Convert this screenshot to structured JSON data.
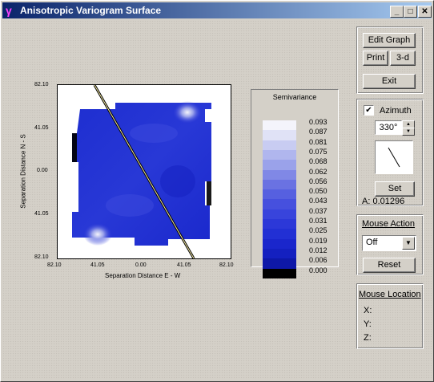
{
  "window": {
    "title": "Anisotropic Variogram Surface",
    "minimize": "_",
    "maximize": "□",
    "close": "✕",
    "icon": "gamma-app-icon"
  },
  "buttons": {
    "edit_graph": "Edit Graph",
    "print": "Print",
    "three_d": "3-d",
    "exit": "Exit",
    "set": "Set",
    "reset": "Reset"
  },
  "azimuth": {
    "label": "Azimuth",
    "checked": true,
    "value": "330°",
    "anisotropy": "A: 0.01296"
  },
  "mouse_action": {
    "title": "Mouse Action",
    "selected": "Off"
  },
  "mouse_location": {
    "title": "Mouse Location",
    "x_label": "X:",
    "y_label": "Y:",
    "z_label": "Z:"
  },
  "chart_data": {
    "type": "heatmap",
    "title": "",
    "xlabel": "Separation Distance E - W",
    "ylabel": "Separation Distance N - S",
    "x_ticks": [
      "82.10",
      "41.05",
      "0.00",
      "41.05",
      "82.10"
    ],
    "y_ticks": [
      "82.10",
      "41.05",
      "0.00",
      "41.05",
      "82.10"
    ],
    "legend": {
      "title": "Semivariance",
      "levels": [
        "0.093",
        "0.087",
        "0.081",
        "0.075",
        "0.068",
        "0.062",
        "0.056",
        "0.050",
        "0.043",
        "0.037",
        "0.031",
        "0.025",
        "0.019",
        "0.012",
        "0.006",
        "0.000"
      ],
      "colors": [
        "#f4f4fb",
        "#e0e2f6",
        "#c8ccf2",
        "#b0b6ee",
        "#9aa2ea",
        "#8088e6",
        "#6a72e2",
        "#5660e0",
        "#4650de",
        "#3844dc",
        "#2c38d8",
        "#2230d4",
        "#1a26cc",
        "#1420c0",
        "#0e18a8",
        "#000000"
      ]
    },
    "azimuth_deg": 330
  }
}
